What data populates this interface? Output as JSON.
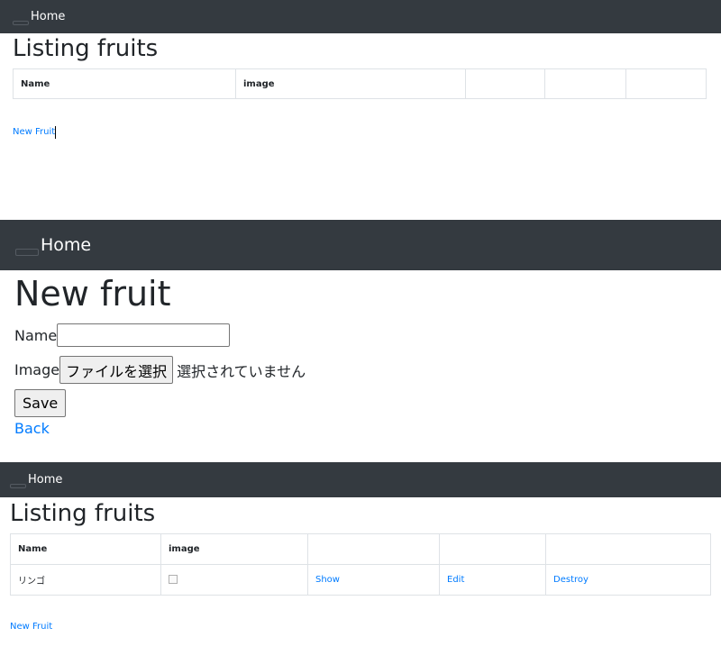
{
  "panels": [
    {
      "nav": {
        "home_label": "Home"
      },
      "title": "Listing fruits",
      "table": {
        "headers": [
          "Name",
          "image",
          "",
          "",
          ""
        ]
      },
      "new_fruit_label": "New Fruit"
    },
    {
      "nav": {
        "home_label": "Home"
      },
      "title": "New fruit",
      "form": {
        "name_label": "Name",
        "name_value": "",
        "image_label": "Image",
        "file_button_label": "ファイルを選択",
        "file_status": "選択されていません",
        "save_label": "Save",
        "back_label": "Back"
      }
    },
    {
      "nav": {
        "home_label": "Home"
      },
      "title": "Listing fruits",
      "table": {
        "headers": [
          "Name",
          "image",
          "",
          "",
          ""
        ],
        "rows": [
          {
            "name": "リンゴ",
            "show_label": "Show",
            "edit_label": "Edit",
            "destroy_label": "Destroy"
          }
        ]
      },
      "new_fruit_label": "New Fruit"
    }
  ],
  "colors": {
    "navbar_bg": "#343a40",
    "link": "#007bff",
    "border": "#dee2e6"
  },
  "icons": {
    "nav_toggle": "menu-toggle-icon",
    "broken_image": "broken-image-icon"
  }
}
